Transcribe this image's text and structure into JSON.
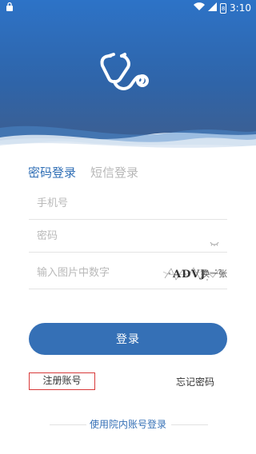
{
  "status_bar": {
    "time": "3:10",
    "battery": "8"
  },
  "tabs": {
    "password_login": "密码登录",
    "sms_login": "短信登录"
  },
  "fields": {
    "phone_placeholder": "手机号",
    "password_placeholder": "密码",
    "captcha_placeholder": "输入图片中数字",
    "captcha_text": "ADVJ",
    "refresh": "换一张"
  },
  "buttons": {
    "login": "登录",
    "register": "注册账号",
    "forgot": "忘记密码",
    "hospital_login": "使用院内账号登录"
  },
  "colors": {
    "primary": "#3570b6",
    "highlight_box": "#d83a3a"
  },
  "icons": [
    "lock-icon",
    "wifi-icon",
    "signal-icon",
    "battery-icon",
    "stethoscope-logo-icon",
    "eye-closed-icon"
  ]
}
